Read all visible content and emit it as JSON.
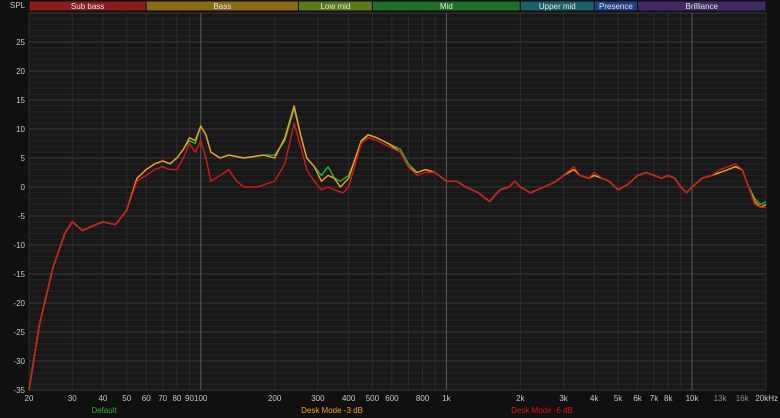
{
  "chart_data": {
    "type": "line",
    "title": "",
    "ylabel": "SPL",
    "xlabel": "",
    "x_scale": "log",
    "xlim": [
      20,
      20000
    ],
    "ylim": [
      -35,
      30
    ],
    "grid": true,
    "bands": [
      {
        "label": "Sub bass",
        "from": 20,
        "to": 60,
        "color": "#8e1b1b"
      },
      {
        "label": "Bass",
        "from": 60,
        "to": 250,
        "color": "#8a6b15"
      },
      {
        "label": "Low mid",
        "from": 250,
        "to": 500,
        "color": "#5a7a1c"
      },
      {
        "label": "Mid",
        "from": 500,
        "to": 2000,
        "color": "#1f6e2a"
      },
      {
        "label": "Upper mid",
        "from": 2000,
        "to": 4000,
        "color": "#1c5f68"
      },
      {
        "label": "Presence",
        "from": 4000,
        "to": 6000,
        "color": "#1f3f86"
      },
      {
        "label": "Brilliance",
        "from": 6000,
        "to": 20000,
        "color": "#3f2a66"
      }
    ],
    "x_ticks": [
      {
        "value": 20,
        "label": "20"
      },
      {
        "value": 30,
        "label": "30"
      },
      {
        "value": 40,
        "label": "40"
      },
      {
        "value": 50,
        "label": "50"
      },
      {
        "value": 60,
        "label": "60"
      },
      {
        "value": 70,
        "label": "70"
      },
      {
        "value": 80,
        "label": "80"
      },
      {
        "value": 90,
        "label": "90"
      },
      {
        "value": 100,
        "label": "100"
      },
      {
        "value": 200,
        "label": "200"
      },
      {
        "value": 300,
        "label": "300"
      },
      {
        "value": 400,
        "label": "400"
      },
      {
        "value": 500,
        "label": "500"
      },
      {
        "value": 600,
        "label": "600"
      },
      {
        "value": 800,
        "label": "800"
      },
      {
        "value": 1000,
        "label": "1k"
      },
      {
        "value": 2000,
        "label": "2k"
      },
      {
        "value": 3000,
        "label": "3k"
      },
      {
        "value": 4000,
        "label": "4k"
      },
      {
        "value": 5000,
        "label": "5k"
      },
      {
        "value": 6000,
        "label": "6k"
      },
      {
        "value": 7000,
        "label": "7k"
      },
      {
        "value": 8000,
        "label": "8k"
      },
      {
        "value": 10000,
        "label": "10k"
      },
      {
        "value": 13000,
        "label": "13k"
      },
      {
        "value": 16000,
        "label": "16k"
      },
      {
        "value": 20000,
        "label": "20kHz"
      }
    ],
    "y_ticks": [
      25,
      20,
      15,
      10,
      5,
      0,
      -5,
      -10,
      -15,
      -20,
      -25,
      -30,
      -35
    ],
    "series": [
      {
        "name": "Default",
        "color": "#2fae2f",
        "points": [
          [
            20,
            -35
          ],
          [
            22,
            -24
          ],
          [
            25,
            -14
          ],
          [
            28,
            -8
          ],
          [
            30,
            -6
          ],
          [
            33,
            -7.5
          ],
          [
            36,
            -6.8
          ],
          [
            40,
            -6
          ],
          [
            45,
            -6.5
          ],
          [
            50,
            -4
          ],
          [
            55,
            1.5
          ],
          [
            60,
            3
          ],
          [
            65,
            4
          ],
          [
            70,
            4.5
          ],
          [
            75,
            4
          ],
          [
            80,
            5
          ],
          [
            85,
            6.5
          ],
          [
            90,
            8
          ],
          [
            95,
            7.5
          ],
          [
            100,
            10.5
          ],
          [
            105,
            9
          ],
          [
            110,
            6
          ],
          [
            120,
            5
          ],
          [
            130,
            5.5
          ],
          [
            150,
            5
          ],
          [
            180,
            5.5
          ],
          [
            200,
            5.5
          ],
          [
            220,
            8
          ],
          [
            240,
            13.5
          ],
          [
            255,
            9
          ],
          [
            270,
            5
          ],
          [
            290,
            3.5
          ],
          [
            310,
            2
          ],
          [
            330,
            3.5
          ],
          [
            350,
            1.5
          ],
          [
            370,
            1
          ],
          [
            400,
            2
          ],
          [
            450,
            7.5
          ],
          [
            480,
            9
          ],
          [
            520,
            8.5
          ],
          [
            580,
            7.5
          ],
          [
            650,
            6.5
          ],
          [
            700,
            4
          ],
          [
            760,
            2.5
          ],
          [
            820,
            3
          ],
          [
            900,
            2.5
          ],
          [
            1000,
            1
          ],
          [
            1100,
            1
          ],
          [
            1200,
            0
          ],
          [
            1350,
            -1
          ],
          [
            1500,
            -2.5
          ],
          [
            1650,
            -0.5
          ],
          [
            1800,
            0
          ],
          [
            1900,
            1
          ],
          [
            2000,
            0
          ],
          [
            2200,
            -1
          ],
          [
            2500,
            0
          ],
          [
            2800,
            1
          ],
          [
            3000,
            2
          ],
          [
            3300,
            3
          ],
          [
            3500,
            2
          ],
          [
            3800,
            1.5
          ],
          [
            4000,
            2
          ],
          [
            4300,
            1.5
          ],
          [
            4600,
            1
          ],
          [
            5000,
            -0.5
          ],
          [
            5500,
            0.5
          ],
          [
            6000,
            2
          ],
          [
            6500,
            2.5
          ],
          [
            7000,
            2
          ],
          [
            7500,
            1.5
          ],
          [
            8000,
            2
          ],
          [
            8500,
            1.5
          ],
          [
            9000,
            0
          ],
          [
            9500,
            -1
          ],
          [
            10000,
            0
          ],
          [
            11000,
            1.5
          ],
          [
            12000,
            2
          ],
          [
            13000,
            2.5
          ],
          [
            14000,
            3
          ],
          [
            15000,
            3.5
          ],
          [
            16000,
            3
          ],
          [
            17000,
            0
          ],
          [
            18000,
            -2
          ],
          [
            19000,
            -3
          ],
          [
            20000,
            -2.5
          ]
        ]
      },
      {
        "name": "Desk Mode -3 dB",
        "color": "#f0a020",
        "points": [
          [
            20,
            -35
          ],
          [
            22,
            -24
          ],
          [
            25,
            -14
          ],
          [
            28,
            -8
          ],
          [
            30,
            -6
          ],
          [
            33,
            -7.5
          ],
          [
            36,
            -6.8
          ],
          [
            40,
            -6
          ],
          [
            45,
            -6.5
          ],
          [
            50,
            -4
          ],
          [
            55,
            1.5
          ],
          [
            60,
            3
          ],
          [
            65,
            4
          ],
          [
            70,
            4.5
          ],
          [
            75,
            4
          ],
          [
            80,
            5
          ],
          [
            85,
            6.5
          ],
          [
            90,
            8.5
          ],
          [
            95,
            8
          ],
          [
            100,
            10.5
          ],
          [
            105,
            9
          ],
          [
            110,
            6
          ],
          [
            120,
            5
          ],
          [
            130,
            5.5
          ],
          [
            150,
            5
          ],
          [
            180,
            5.5
          ],
          [
            200,
            5
          ],
          [
            220,
            8.5
          ],
          [
            240,
            14
          ],
          [
            255,
            9
          ],
          [
            270,
            5
          ],
          [
            290,
            3.5
          ],
          [
            310,
            1
          ],
          [
            330,
            2
          ],
          [
            350,
            1.5
          ],
          [
            370,
            0
          ],
          [
            400,
            1.5
          ],
          [
            450,
            8
          ],
          [
            480,
            9
          ],
          [
            520,
            8.5
          ],
          [
            580,
            7.5
          ],
          [
            650,
            6
          ],
          [
            700,
            3.5
          ],
          [
            760,
            2.5
          ],
          [
            820,
            3
          ],
          [
            900,
            2.5
          ],
          [
            1000,
            1
          ],
          [
            1100,
            1
          ],
          [
            1200,
            0
          ],
          [
            1350,
            -1
          ],
          [
            1500,
            -2.5
          ],
          [
            1650,
            -0.5
          ],
          [
            1800,
            0
          ],
          [
            1900,
            1
          ],
          [
            2000,
            0
          ],
          [
            2200,
            -1
          ],
          [
            2500,
            0
          ],
          [
            2800,
            1
          ],
          [
            3000,
            2
          ],
          [
            3300,
            3
          ],
          [
            3500,
            2
          ],
          [
            3800,
            1.5
          ],
          [
            4000,
            2
          ],
          [
            4300,
            1.5
          ],
          [
            4600,
            1
          ],
          [
            5000,
            -0.5
          ],
          [
            5500,
            0.5
          ],
          [
            6000,
            2
          ],
          [
            6500,
            2.5
          ],
          [
            7000,
            2
          ],
          [
            7500,
            1.5
          ],
          [
            8000,
            2
          ],
          [
            8500,
            1.5
          ],
          [
            9000,
            0
          ],
          [
            9500,
            -1
          ],
          [
            10000,
            0
          ],
          [
            11000,
            1.5
          ],
          [
            12000,
            2
          ],
          [
            13000,
            2.5
          ],
          [
            14000,
            3
          ],
          [
            15000,
            3.5
          ],
          [
            16000,
            3
          ],
          [
            17000,
            0
          ],
          [
            18000,
            -2.5
          ],
          [
            19000,
            -3.5
          ],
          [
            20000,
            -3
          ]
        ]
      },
      {
        "name": "Desk Mode -6 dB",
        "color": "#d01a1a",
        "points": [
          [
            20,
            -35
          ],
          [
            22,
            -24
          ],
          [
            25,
            -14
          ],
          [
            28,
            -8
          ],
          [
            30,
            -6
          ],
          [
            33,
            -7.5
          ],
          [
            36,
            -6.8
          ],
          [
            40,
            -6
          ],
          [
            45,
            -6.5
          ],
          [
            50,
            -4
          ],
          [
            55,
            1
          ],
          [
            60,
            2
          ],
          [
            65,
            3
          ],
          [
            70,
            3.5
          ],
          [
            75,
            3
          ],
          [
            80,
            3
          ],
          [
            85,
            5
          ],
          [
            90,
            7.5
          ],
          [
            95,
            6
          ],
          [
            100,
            8
          ],
          [
            105,
            5
          ],
          [
            110,
            1
          ],
          [
            120,
            2
          ],
          [
            130,
            3
          ],
          [
            140,
            1
          ],
          [
            150,
            0
          ],
          [
            170,
            0
          ],
          [
            200,
            1
          ],
          [
            220,
            4
          ],
          [
            240,
            11
          ],
          [
            255,
            7
          ],
          [
            270,
            3
          ],
          [
            290,
            1
          ],
          [
            310,
            -0.5
          ],
          [
            330,
            0
          ],
          [
            350,
            -0.5
          ],
          [
            380,
            -1
          ],
          [
            400,
            0
          ],
          [
            450,
            7.5
          ],
          [
            480,
            8.5
          ],
          [
            520,
            8
          ],
          [
            580,
            7
          ],
          [
            650,
            6
          ],
          [
            700,
            3.5
          ],
          [
            760,
            2
          ],
          [
            820,
            2.5
          ],
          [
            900,
            2.5
          ],
          [
            1000,
            1
          ],
          [
            1100,
            1
          ],
          [
            1200,
            0
          ],
          [
            1350,
            -1
          ],
          [
            1500,
            -2.5
          ],
          [
            1650,
            -0.5
          ],
          [
            1800,
            0
          ],
          [
            1900,
            1
          ],
          [
            2000,
            0
          ],
          [
            2200,
            -1
          ],
          [
            2500,
            0
          ],
          [
            2800,
            1
          ],
          [
            3000,
            2
          ],
          [
            3300,
            3.5
          ],
          [
            3500,
            2
          ],
          [
            3800,
            1.5
          ],
          [
            4000,
            2.5
          ],
          [
            4300,
            1.5
          ],
          [
            4600,
            1
          ],
          [
            5000,
            -0.5
          ],
          [
            5500,
            0.5
          ],
          [
            6000,
            2
          ],
          [
            6500,
            2.5
          ],
          [
            7000,
            2
          ],
          [
            7500,
            1.5
          ],
          [
            8000,
            2
          ],
          [
            8500,
            1.5
          ],
          [
            9000,
            0
          ],
          [
            9500,
            -1
          ],
          [
            10000,
            0
          ],
          [
            11000,
            1.5
          ],
          [
            12000,
            2
          ],
          [
            13000,
            3
          ],
          [
            14000,
            3.5
          ],
          [
            15000,
            4
          ],
          [
            16000,
            3
          ],
          [
            17000,
            0
          ],
          [
            18000,
            -3
          ],
          [
            19000,
            -3.5
          ],
          [
            20000,
            -3.5
          ]
        ]
      }
    ]
  }
}
